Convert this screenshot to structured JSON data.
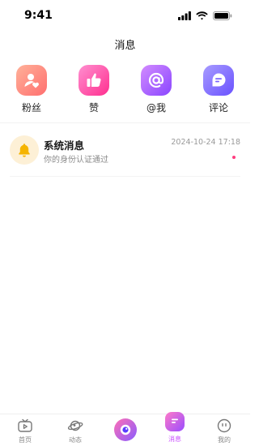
{
  "status_bar": {
    "time": "9:41"
  },
  "header": {
    "title": "消息"
  },
  "quick_actions": [
    {
      "label": "粉丝",
      "icon": "fans-icon"
    },
    {
      "label": "赞",
      "icon": "thumbs-up-icon"
    },
    {
      "label": "@我",
      "icon": "at-icon"
    },
    {
      "label": "评论",
      "icon": "comment-icon"
    }
  ],
  "messages": [
    {
      "title": "系统消息",
      "preview": "你的身份认证通过",
      "time": "2024-10-24 17:18",
      "icon": "bell-icon",
      "unread": true
    }
  ],
  "tabbar": {
    "items": [
      {
        "label": "首页",
        "icon": "tv-home-icon"
      },
      {
        "label": "动态",
        "icon": "planet-icon"
      },
      {
        "label": "",
        "icon": "camera-lens-icon"
      },
      {
        "label": "消息",
        "icon": "message-icon",
        "active": true
      },
      {
        "label": "我的",
        "icon": "profile-face-icon"
      }
    ]
  },
  "colors": {
    "accent_pink": "#ff3d7f",
    "active_tab": "#c94dff",
    "fans": "#ff8a7a",
    "like": "#ff4fa8",
    "at": "#9b5cff",
    "comment": "#7b6bff",
    "bell": "#f5b400"
  }
}
